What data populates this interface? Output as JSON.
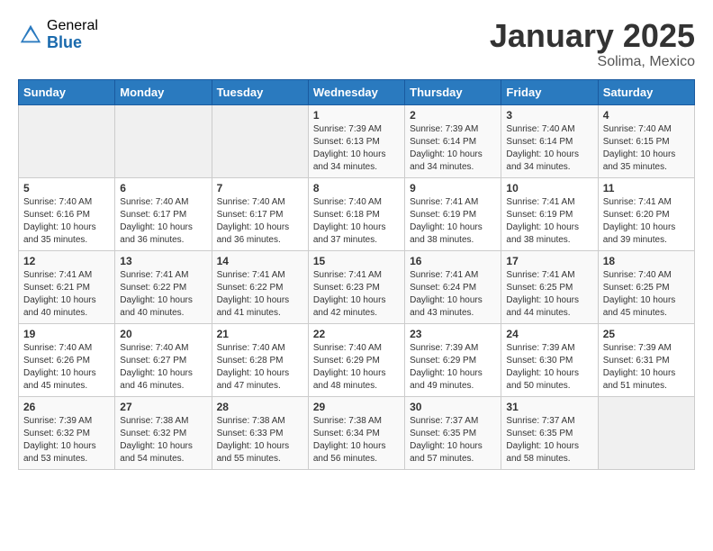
{
  "header": {
    "logo_general": "General",
    "logo_blue": "Blue",
    "title": "January 2025",
    "subtitle": "Solima, Mexico"
  },
  "weekdays": [
    "Sunday",
    "Monday",
    "Tuesday",
    "Wednesday",
    "Thursday",
    "Friday",
    "Saturday"
  ],
  "weeks": [
    [
      {
        "day": "",
        "info": ""
      },
      {
        "day": "",
        "info": ""
      },
      {
        "day": "",
        "info": ""
      },
      {
        "day": "1",
        "info": "Sunrise: 7:39 AM\nSunset: 6:13 PM\nDaylight: 10 hours\nand 34 minutes."
      },
      {
        "day": "2",
        "info": "Sunrise: 7:39 AM\nSunset: 6:14 PM\nDaylight: 10 hours\nand 34 minutes."
      },
      {
        "day": "3",
        "info": "Sunrise: 7:40 AM\nSunset: 6:14 PM\nDaylight: 10 hours\nand 34 minutes."
      },
      {
        "day": "4",
        "info": "Sunrise: 7:40 AM\nSunset: 6:15 PM\nDaylight: 10 hours\nand 35 minutes."
      }
    ],
    [
      {
        "day": "5",
        "info": "Sunrise: 7:40 AM\nSunset: 6:16 PM\nDaylight: 10 hours\nand 35 minutes."
      },
      {
        "day": "6",
        "info": "Sunrise: 7:40 AM\nSunset: 6:17 PM\nDaylight: 10 hours\nand 36 minutes."
      },
      {
        "day": "7",
        "info": "Sunrise: 7:40 AM\nSunset: 6:17 PM\nDaylight: 10 hours\nand 36 minutes."
      },
      {
        "day": "8",
        "info": "Sunrise: 7:40 AM\nSunset: 6:18 PM\nDaylight: 10 hours\nand 37 minutes."
      },
      {
        "day": "9",
        "info": "Sunrise: 7:41 AM\nSunset: 6:19 PM\nDaylight: 10 hours\nand 38 minutes."
      },
      {
        "day": "10",
        "info": "Sunrise: 7:41 AM\nSunset: 6:19 PM\nDaylight: 10 hours\nand 38 minutes."
      },
      {
        "day": "11",
        "info": "Sunrise: 7:41 AM\nSunset: 6:20 PM\nDaylight: 10 hours\nand 39 minutes."
      }
    ],
    [
      {
        "day": "12",
        "info": "Sunrise: 7:41 AM\nSunset: 6:21 PM\nDaylight: 10 hours\nand 40 minutes."
      },
      {
        "day": "13",
        "info": "Sunrise: 7:41 AM\nSunset: 6:22 PM\nDaylight: 10 hours\nand 40 minutes."
      },
      {
        "day": "14",
        "info": "Sunrise: 7:41 AM\nSunset: 6:22 PM\nDaylight: 10 hours\nand 41 minutes."
      },
      {
        "day": "15",
        "info": "Sunrise: 7:41 AM\nSunset: 6:23 PM\nDaylight: 10 hours\nand 42 minutes."
      },
      {
        "day": "16",
        "info": "Sunrise: 7:41 AM\nSunset: 6:24 PM\nDaylight: 10 hours\nand 43 minutes."
      },
      {
        "day": "17",
        "info": "Sunrise: 7:41 AM\nSunset: 6:25 PM\nDaylight: 10 hours\nand 44 minutes."
      },
      {
        "day": "18",
        "info": "Sunrise: 7:40 AM\nSunset: 6:25 PM\nDaylight: 10 hours\nand 45 minutes."
      }
    ],
    [
      {
        "day": "19",
        "info": "Sunrise: 7:40 AM\nSunset: 6:26 PM\nDaylight: 10 hours\nand 45 minutes."
      },
      {
        "day": "20",
        "info": "Sunrise: 7:40 AM\nSunset: 6:27 PM\nDaylight: 10 hours\nand 46 minutes."
      },
      {
        "day": "21",
        "info": "Sunrise: 7:40 AM\nSunset: 6:28 PM\nDaylight: 10 hours\nand 47 minutes."
      },
      {
        "day": "22",
        "info": "Sunrise: 7:40 AM\nSunset: 6:29 PM\nDaylight: 10 hours\nand 48 minutes."
      },
      {
        "day": "23",
        "info": "Sunrise: 7:39 AM\nSunset: 6:29 PM\nDaylight: 10 hours\nand 49 minutes."
      },
      {
        "day": "24",
        "info": "Sunrise: 7:39 AM\nSunset: 6:30 PM\nDaylight: 10 hours\nand 50 minutes."
      },
      {
        "day": "25",
        "info": "Sunrise: 7:39 AM\nSunset: 6:31 PM\nDaylight: 10 hours\nand 51 minutes."
      }
    ],
    [
      {
        "day": "26",
        "info": "Sunrise: 7:39 AM\nSunset: 6:32 PM\nDaylight: 10 hours\nand 53 minutes."
      },
      {
        "day": "27",
        "info": "Sunrise: 7:38 AM\nSunset: 6:32 PM\nDaylight: 10 hours\nand 54 minutes."
      },
      {
        "day": "28",
        "info": "Sunrise: 7:38 AM\nSunset: 6:33 PM\nDaylight: 10 hours\nand 55 minutes."
      },
      {
        "day": "29",
        "info": "Sunrise: 7:38 AM\nSunset: 6:34 PM\nDaylight: 10 hours\nand 56 minutes."
      },
      {
        "day": "30",
        "info": "Sunrise: 7:37 AM\nSunset: 6:35 PM\nDaylight: 10 hours\nand 57 minutes."
      },
      {
        "day": "31",
        "info": "Sunrise: 7:37 AM\nSunset: 6:35 PM\nDaylight: 10 hours\nand 58 minutes."
      },
      {
        "day": "",
        "info": ""
      }
    ]
  ]
}
